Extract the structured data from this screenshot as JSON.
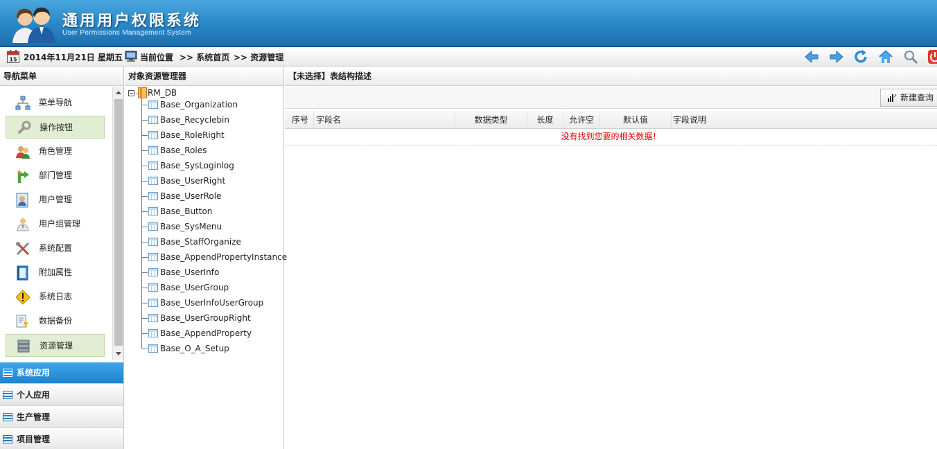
{
  "header": {
    "title": "通用用户权限系统",
    "subtitle": "User Permissions Management System"
  },
  "infobar": {
    "date": "2014年11月21日 星期五",
    "calendar_day": "15",
    "location_label": "当前位置",
    "breadcrumb": [
      ">> 系统首页",
      ">> 资源管理"
    ],
    "toolbar_icons": [
      "back-arrow-icon",
      "forward-arrow-icon",
      "refresh-icon",
      "home-icon",
      "search-icon",
      "power-icon"
    ]
  },
  "nav": {
    "title": "导航菜单",
    "items": [
      {
        "label": "菜单导航",
        "icon": "sitemap-icon",
        "selected": false
      },
      {
        "label": "操作按钮",
        "icon": "wrench-icon",
        "selected": true
      },
      {
        "label": "角色管理",
        "icon": "users-icon",
        "selected": false
      },
      {
        "label": "部门管理",
        "icon": "branch-arrow-icon",
        "selected": false
      },
      {
        "label": "用户管理",
        "icon": "user-card-icon",
        "selected": false
      },
      {
        "label": "用户组管理",
        "icon": "user-group-icon",
        "selected": false
      },
      {
        "label": "系统配置",
        "icon": "tools-icon",
        "selected": false
      },
      {
        "label": "附加属性",
        "icon": "book-icon",
        "selected": false
      },
      {
        "label": "系统日志",
        "icon": "warning-icon",
        "selected": false
      },
      {
        "label": "数据备份",
        "icon": "backup-doc-icon",
        "selected": false
      },
      {
        "label": "资源管理",
        "icon": "database-icon",
        "selected": true
      }
    ],
    "groups": [
      {
        "label": "系统应用",
        "active": true
      },
      {
        "label": "个人应用",
        "active": false
      },
      {
        "label": "生产管理",
        "active": false
      },
      {
        "label": "项目管理",
        "active": false
      }
    ]
  },
  "tree": {
    "title": "对象资源管理器",
    "root": "RM_DB",
    "nodes": [
      "Base_Organization",
      "Base_Recyclebin",
      "Base_RoleRight",
      "Base_Roles",
      "Base_SysLoginlog",
      "Base_UserRight",
      "Base_UserRole",
      "Base_Button",
      "Base_SysMenu",
      "Base_StaffOrganize",
      "Base_AppendPropertyInstance",
      "Base_UserInfo",
      "Base_UserGroup",
      "Base_UserInfoUserGroup",
      "Base_UserGroupRight",
      "Base_AppendProperty",
      "Base_O_A_Setup"
    ]
  },
  "main": {
    "title": "【未选择】表结构描述",
    "new_query_label": "新建查询",
    "columns": [
      "序号",
      "字段名",
      "数据类型",
      "长度",
      "允许空",
      "默认值",
      "字段说明"
    ],
    "empty_message": "没有找到您要的相关数据！"
  },
  "colors": {
    "header_blue": "#2d8ccc",
    "active_group": "#1c83cf",
    "selected_item_bg": "#e2eed3",
    "empty_text": "#e00000"
  }
}
